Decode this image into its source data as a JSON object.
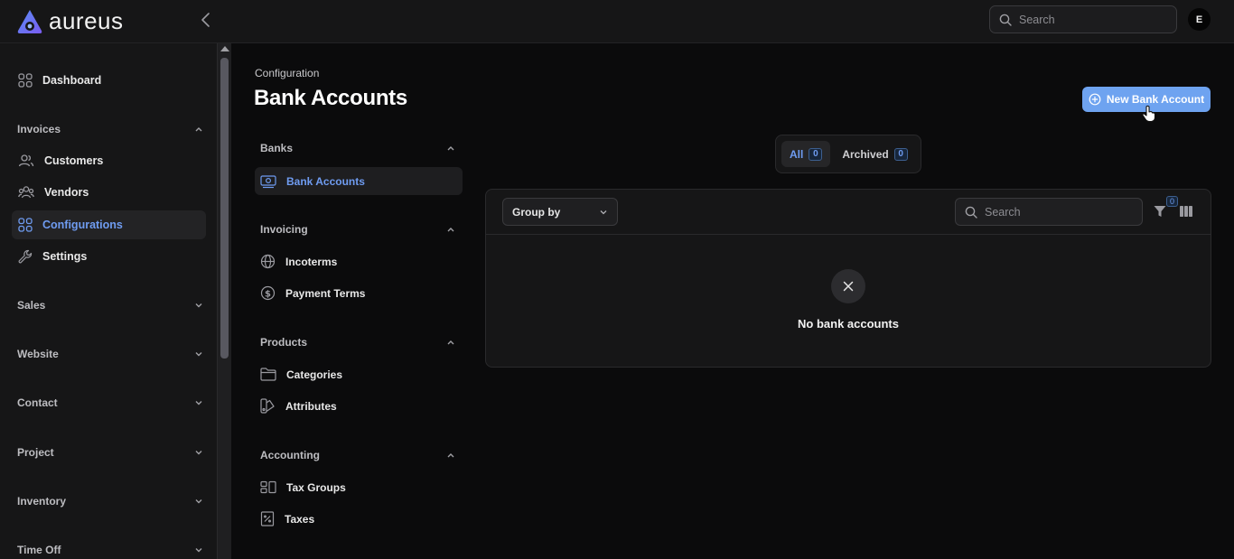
{
  "app": {
    "logo_text": "aureus",
    "avatar_initial": "E"
  },
  "topbar": {
    "search_placeholder": "Search"
  },
  "sidebar": {
    "dashboard": "Dashboard",
    "groups": {
      "invoices": "Invoices",
      "sales": "Sales",
      "website": "Website",
      "contact": "Contact",
      "project": "Project",
      "inventory": "Inventory",
      "time_off": "Time Off"
    },
    "items": {
      "customers": "Customers",
      "vendors": "Vendors",
      "configurations": "Configurations",
      "settings": "Settings"
    }
  },
  "page": {
    "breadcrumb": "Configuration",
    "title": "Bank Accounts",
    "new_button": "New Bank Account"
  },
  "subnav": {
    "banks": {
      "label": "Banks",
      "items": [
        "Bank Accounts"
      ]
    },
    "invoicing": {
      "label": "Invoicing",
      "items": [
        "Incoterms",
        "Payment Terms"
      ]
    },
    "products": {
      "label": "Products",
      "items": [
        "Categories",
        "Attributes"
      ]
    },
    "accounting": {
      "label": "Accounting",
      "items": [
        "Tax Groups",
        "Taxes"
      ]
    }
  },
  "tabs": {
    "all": {
      "label": "All",
      "count": "0"
    },
    "archived": {
      "label": "Archived",
      "count": "0"
    }
  },
  "table": {
    "group_by": "Group by",
    "search_placeholder": "Search",
    "filter_count": "0",
    "empty_text": "No bank accounts"
  },
  "colors": {
    "accent": "#6f9cf1",
    "button": "#6ea3f0",
    "background": "#0b0b0c",
    "surface": "#161617"
  }
}
